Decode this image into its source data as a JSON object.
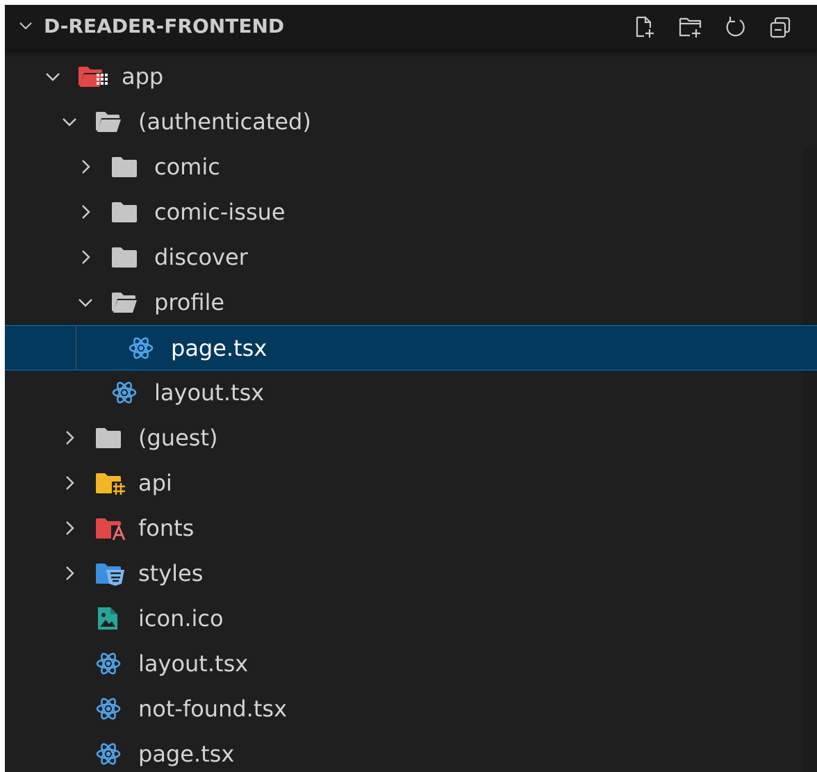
{
  "explorer": {
    "section_title": "D-READER-FRONTEND",
    "actions": [
      {
        "name": "new-file-icon",
        "label": "New File"
      },
      {
        "name": "new-folder-icon",
        "label": "New Folder"
      },
      {
        "name": "refresh-icon",
        "label": "Refresh Explorer"
      },
      {
        "name": "collapse-all-icon",
        "label": "Collapse Folders in Explorer"
      }
    ],
    "tree": [
      {
        "label": "app",
        "type": "folder",
        "expanded": true,
        "icon": "app-folder-open-icon",
        "depth": 0
      },
      {
        "label": "(authenticated)",
        "type": "folder",
        "expanded": true,
        "icon": "folder-open-icon",
        "depth": 1
      },
      {
        "label": "comic",
        "type": "folder",
        "expanded": false,
        "icon": "folder-icon",
        "depth": 2
      },
      {
        "label": "comic-issue",
        "type": "folder",
        "expanded": false,
        "icon": "folder-icon",
        "depth": 2
      },
      {
        "label": "discover",
        "type": "folder",
        "expanded": false,
        "icon": "folder-icon",
        "depth": 2
      },
      {
        "label": "profile",
        "type": "folder",
        "expanded": true,
        "icon": "folder-open-icon",
        "depth": 2
      },
      {
        "label": "page.tsx",
        "type": "file",
        "icon": "react-icon",
        "depth": 3,
        "selected": true
      },
      {
        "label": "layout.tsx",
        "type": "file",
        "icon": "react-icon",
        "depth": 2
      },
      {
        "label": "(guest)",
        "type": "folder",
        "expanded": false,
        "icon": "folder-icon",
        "depth": 1
      },
      {
        "label": "api",
        "type": "folder",
        "expanded": false,
        "icon": "api-folder-icon",
        "depth": 1
      },
      {
        "label": "fonts",
        "type": "folder",
        "expanded": false,
        "icon": "fonts-folder-icon",
        "depth": 1
      },
      {
        "label": "styles",
        "type": "folder",
        "expanded": false,
        "icon": "styles-folder-icon",
        "depth": 1
      },
      {
        "label": "icon.ico",
        "type": "file",
        "icon": "image-file-icon",
        "depth": 1
      },
      {
        "label": "layout.tsx",
        "type": "file",
        "icon": "react-icon",
        "depth": 1
      },
      {
        "label": "not-found.tsx",
        "type": "file",
        "icon": "react-icon",
        "depth": 1
      },
      {
        "label": "page.tsx",
        "type": "file",
        "icon": "react-icon",
        "depth": 1
      }
    ]
  },
  "colors": {
    "background": "#1f1f1f",
    "header_background": "#181818",
    "selection": "#04395e",
    "selection_border": "#0078d4",
    "text": "#d4d4d4",
    "folder_gray": "#c5c5c5",
    "react_blue": "#4fa3e8",
    "app_folder_red": "#e04848",
    "api_folder_yellow": "#f2b624",
    "styles_folder_blue": "#3d8fe0",
    "image_teal": "#26a69a"
  }
}
